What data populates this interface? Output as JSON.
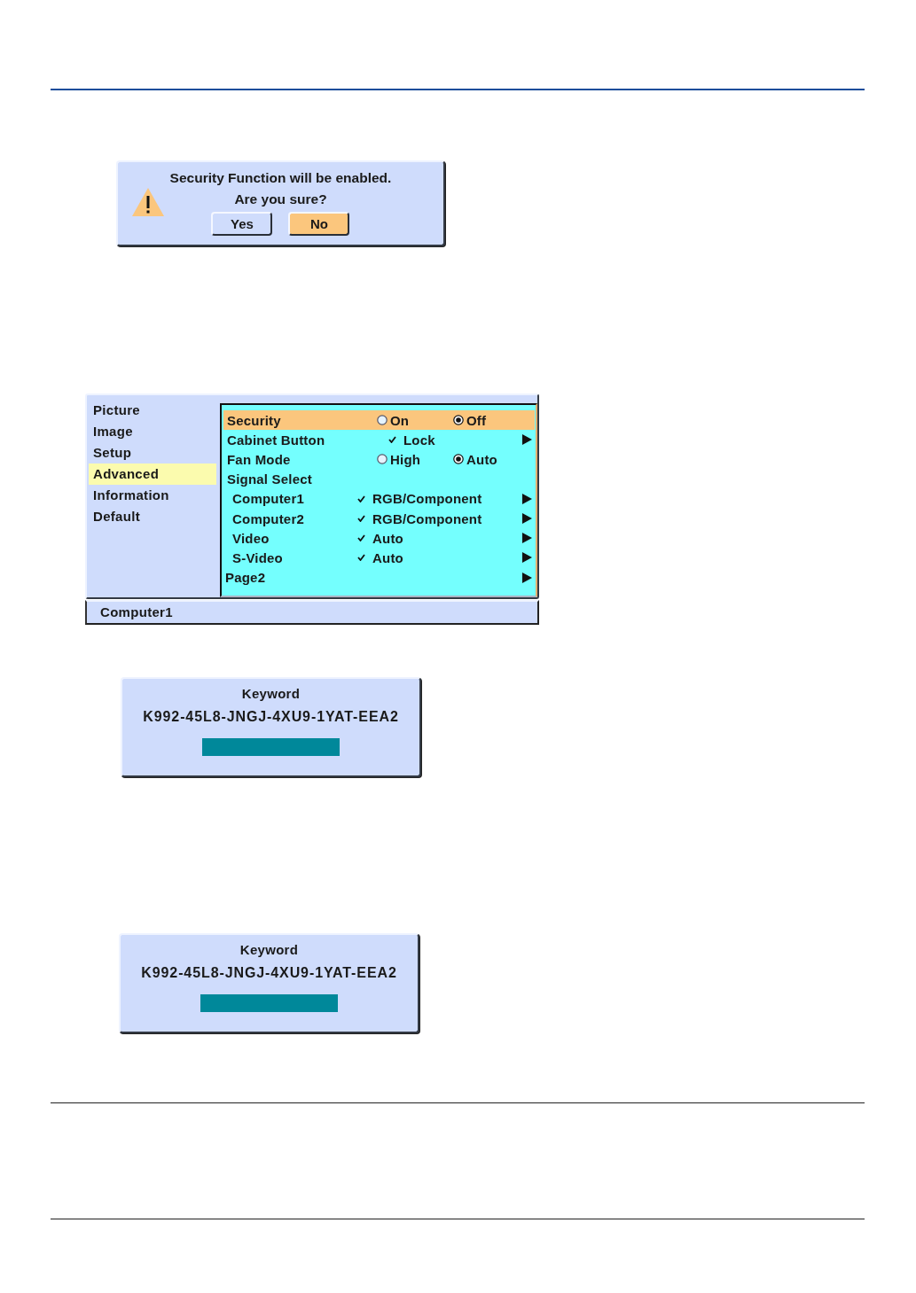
{
  "confirm_dialog": {
    "message": "Security Function will be enabled.",
    "question": "Are you sure?",
    "buttons": [
      {
        "label": "Yes",
        "selected": false
      },
      {
        "label": "No",
        "selected": true
      }
    ]
  },
  "menu": {
    "tabs": [
      {
        "label": "Picture",
        "selected": false
      },
      {
        "label": "Image",
        "selected": false
      },
      {
        "label": "Setup",
        "selected": false
      },
      {
        "label": "Advanced",
        "selected": true
      },
      {
        "label": "Information",
        "selected": false
      },
      {
        "label": "Default",
        "selected": false
      }
    ],
    "rows": [
      {
        "kind": "radio",
        "label": "Security",
        "selected": true,
        "submenu": false,
        "options": [
          {
            "label": "On",
            "selected": false
          },
          {
            "label": "Off",
            "selected": true
          }
        ]
      },
      {
        "kind": "check",
        "label": "Cabinet Button",
        "value": "Lock",
        "selected": false,
        "submenu": true
      },
      {
        "kind": "radio",
        "label": "Fan Mode",
        "selected": false,
        "submenu": false,
        "options": [
          {
            "label": "High",
            "selected": false
          },
          {
            "label": "Auto",
            "selected": true
          }
        ]
      },
      {
        "kind": "group",
        "label": "Signal Select",
        "selected": false,
        "submenu": false,
        "children": [
          {
            "kind": "check",
            "label": "Computer1",
            "value": "RGB/Component",
            "selected": false,
            "submenu": true
          },
          {
            "kind": "check",
            "label": "Computer2",
            "value": "RGB/Component",
            "selected": false,
            "submenu": true
          },
          {
            "kind": "check",
            "label": "Video",
            "value": "Auto",
            "selected": false,
            "submenu": true
          },
          {
            "kind": "check",
            "label": "S-Video",
            "value": "Auto",
            "selected": false,
            "submenu": true
          }
        ]
      },
      {
        "kind": "link",
        "label": "Page2",
        "selected": false,
        "submenu": true
      }
    ],
    "status_bar": "Computer1"
  },
  "keyword_dialogs": [
    {
      "title": "Keyword",
      "code": "K992-45L8-JNGJ-4XU9-1YAT-EEA2"
    },
    {
      "title": "Keyword",
      "code": "K992-45L8-JNGJ-4XU9-1YAT-EEA2"
    }
  ]
}
